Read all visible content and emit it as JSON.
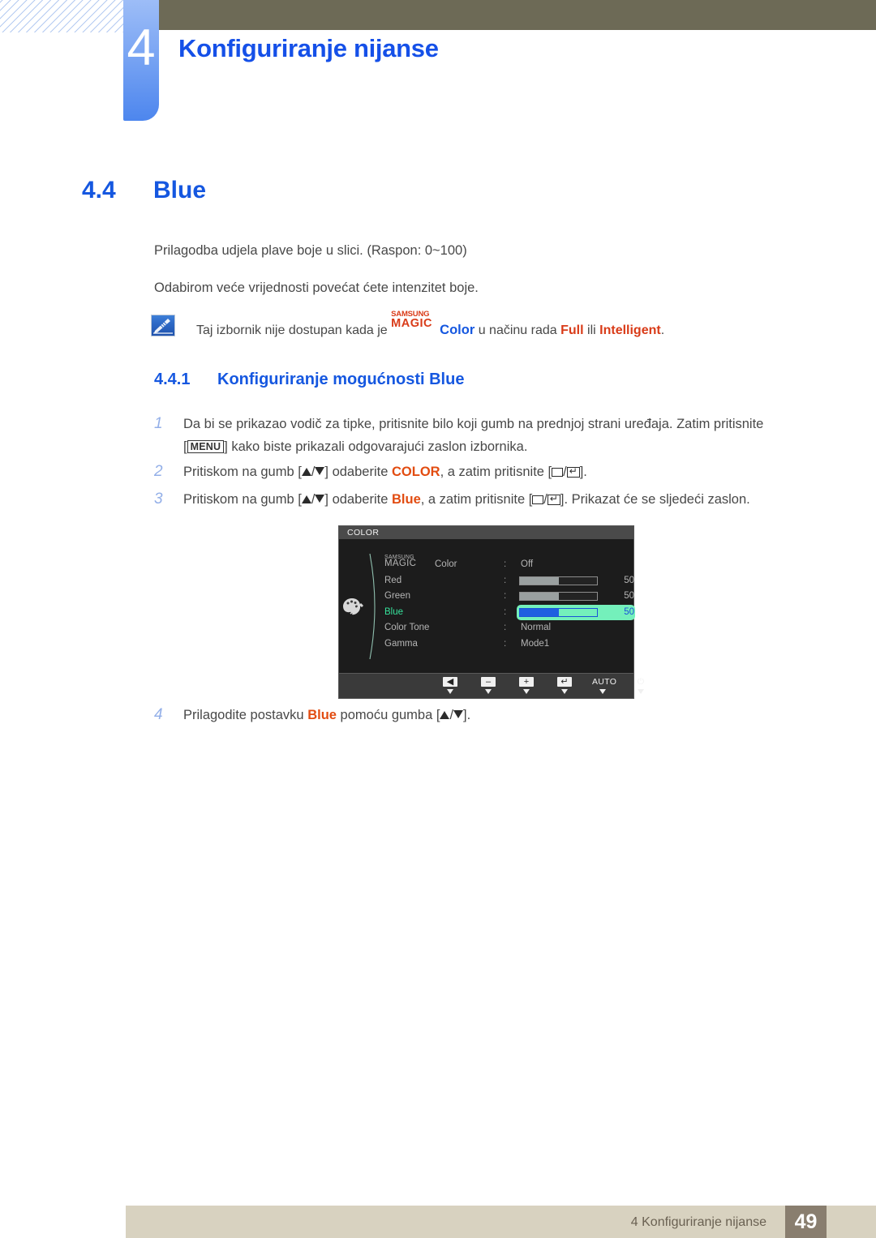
{
  "header": {
    "chapter_number": "4",
    "chapter_title": "Konfiguriranje nijanse"
  },
  "section": {
    "number": "4.4",
    "title": "Blue"
  },
  "paragraphs": {
    "intro": "Prilagodba udjela plave boje u slici. (Raspon: 0~100)",
    "detail": "Odabirom veće vrijednosti povećat ćete intenzitet boje."
  },
  "note": {
    "icon": "note-pencil-icon",
    "text_before": "Taj izbornik nije dostupan kada je",
    "logo_samsung": "SAMSUNG",
    "logo_magic": "MAGIC",
    "logo_color": "Color",
    "text_middle": "u načinu rada",
    "keyword_full": "Full",
    "text_or": "ili",
    "keyword_intelligent": "Intelligent",
    "text_end": "."
  },
  "subsection": {
    "number": "4.4.1",
    "title": "Konfiguriranje mogućnosti Blue"
  },
  "steps": [
    {
      "number": "1",
      "part1": "Da bi se prikazao vodič za tipke, pritisnite bilo koji gumb na prednjoj strani uređaja. Zatim pritisnite",
      "key": "MENU",
      "part2": "kako biste prikazali odgovarajući zaslon izbornika."
    },
    {
      "number": "2",
      "part1": "Pritiskom na gumb [",
      "part2": "] odaberite",
      "keyword": "COLOR",
      "part3": ", a zatim pritisnite [",
      "part4": "]."
    },
    {
      "number": "3",
      "part1": "Pritiskom na gumb [",
      "part2": "] odaberite",
      "keyword": "Blue",
      "part3": ", a zatim pritisnite [",
      "part4": "]. Prikazat će se sljedeći zaslon."
    },
    {
      "number": "4",
      "part1": "Prilagodite postavku",
      "keyword": "Blue",
      "part2": "pomoću gumba [",
      "part3": "]."
    }
  ],
  "osd": {
    "title": "COLOR",
    "palette_icon": "palette-icon",
    "rows": [
      {
        "label_samsung": "SAMSUNG",
        "label_magic": "MAGIC",
        "label_color": "Color",
        "separator": ":",
        "value": "Off",
        "type": "text"
      },
      {
        "label": "Red",
        "separator": ":",
        "value": 50,
        "type": "slider",
        "percent": 50
      },
      {
        "label": "Green",
        "separator": ":",
        "value": 50,
        "type": "slider",
        "percent": 50
      },
      {
        "label": "Blue",
        "separator": ":",
        "value": 50,
        "type": "slider",
        "percent": 50,
        "highlighted": true
      },
      {
        "label": "Color Tone",
        "separator": ":",
        "value": "Normal",
        "type": "text"
      },
      {
        "label": "Gamma",
        "separator": ":",
        "value": "Mode1",
        "type": "text"
      }
    ],
    "buttons": [
      {
        "name": "left-arrow-button",
        "glyph": "◀",
        "style": "cap"
      },
      {
        "name": "minus-button",
        "glyph": "–",
        "style": "cap"
      },
      {
        "name": "plus-button",
        "glyph": "+",
        "style": "cap"
      },
      {
        "name": "enter-button",
        "glyph": "↵",
        "style": "cap"
      },
      {
        "name": "auto-button",
        "glyph": "AUTO",
        "style": "text"
      },
      {
        "name": "power-button",
        "glyph": "⏻",
        "style": "text"
      }
    ],
    "colors": {
      "highlight": "#74f0bb",
      "highlight_text": "#1a53d8",
      "slider_fill": "#1f5fe0",
      "background": "#1c1c1c"
    }
  },
  "footer": {
    "text": "4 Konfiguriranje nijanse",
    "page": "49"
  },
  "colors": {
    "heading_blue": "#1557e0",
    "keyword_orange": "#e24c11",
    "keyword_red": "#d93b18",
    "header_bar": "#6d6a56",
    "footer_bar": "#d8d2c0",
    "footer_page_box": "#897e6f"
  }
}
